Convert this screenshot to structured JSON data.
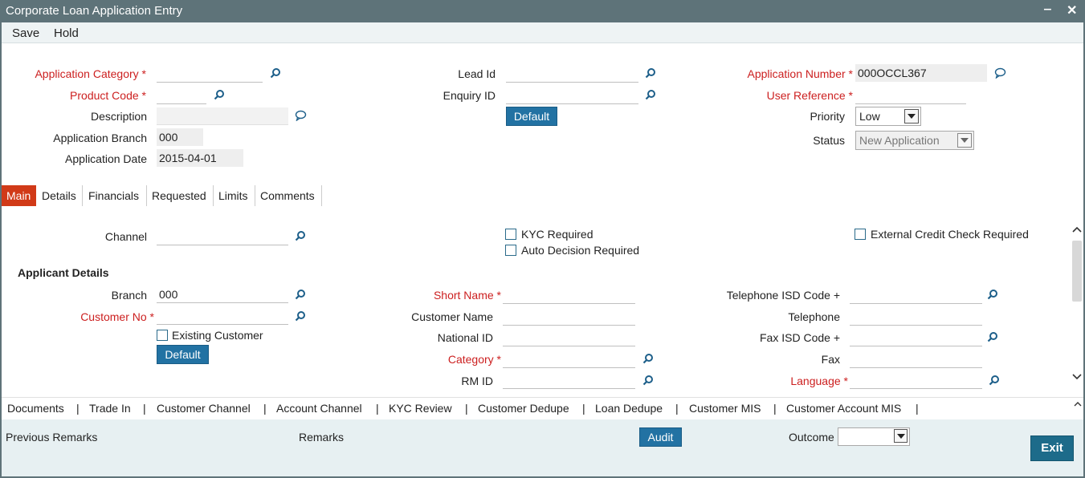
{
  "window": {
    "title": "Corporate Loan Application Entry",
    "minimize_glyph": "‒",
    "close_glyph": "✕"
  },
  "menu": {
    "save": "Save",
    "hold": "Hold"
  },
  "header": {
    "application_category": {
      "label": "Application Category",
      "value": ""
    },
    "product_code": {
      "label": "Product Code",
      "value": ""
    },
    "description": {
      "label": "Description",
      "value": ""
    },
    "application_branch": {
      "label": "Application Branch",
      "value": "000"
    },
    "application_date": {
      "label": "Application Date",
      "value": "2015-04-01"
    },
    "lead_id": {
      "label": "Lead Id",
      "value": ""
    },
    "enquiry_id": {
      "label": "Enquiry ID",
      "value": ""
    },
    "default_button": "Default",
    "application_number": {
      "label": "Application Number",
      "value": "000OCCL367"
    },
    "user_reference": {
      "label": "User Reference",
      "value": ""
    },
    "priority": {
      "label": "Priority",
      "value": "Low"
    },
    "status": {
      "label": "Status",
      "value": "New Application"
    },
    "required_marker": "*"
  },
  "tabs": [
    "Main",
    "Details",
    "Financials",
    "Requested",
    "Limits",
    "Comments"
  ],
  "main": {
    "channel": {
      "label": "Channel",
      "value": ""
    },
    "kyc_required": "KYC Required",
    "auto_decision_required": "Auto Decision Required",
    "external_credit_check_required": "External Credit Check Required",
    "applicant_details_title": "Applicant Details",
    "branch": {
      "label": "Branch",
      "value": "000"
    },
    "customer_no": {
      "label": "Customer No",
      "value": ""
    },
    "existing_customer": "Existing Customer",
    "default_button": "Default",
    "short_name": {
      "label": "Short Name",
      "value": ""
    },
    "customer_name": {
      "label": "Customer Name",
      "value": ""
    },
    "national_id": {
      "label": "National ID",
      "value": ""
    },
    "category": {
      "label": "Category",
      "value": ""
    },
    "rm_id": {
      "label": "RM ID",
      "value": ""
    },
    "telephone_isd": {
      "label": "Telephone ISD Code +",
      "value": ""
    },
    "telephone": {
      "label": "Telephone",
      "value": ""
    },
    "fax_isd": {
      "label": "Fax ISD Code +",
      "value": ""
    },
    "fax": {
      "label": "Fax",
      "value": ""
    },
    "language": {
      "label": "Language",
      "value": ""
    }
  },
  "links": [
    "Documents",
    "Trade In",
    "Customer Channel",
    "Account Channel",
    "KYC Review",
    "Customer Dedupe",
    "Loan Dedupe",
    "Customer MIS",
    "Customer Account MIS"
  ],
  "link_separator": "|",
  "footer": {
    "previous_remarks": "Previous Remarks",
    "remarks": "Remarks",
    "audit": "Audit",
    "outcome": {
      "label": "Outcome",
      "value": ""
    },
    "exit": "Exit"
  },
  "colors": {
    "title_bar": "#5e7379",
    "required_label": "#cc1f1f",
    "active_tab": "#d13a18",
    "button_blue": "#2272a3",
    "footer_bg": "#e7f0f2"
  }
}
